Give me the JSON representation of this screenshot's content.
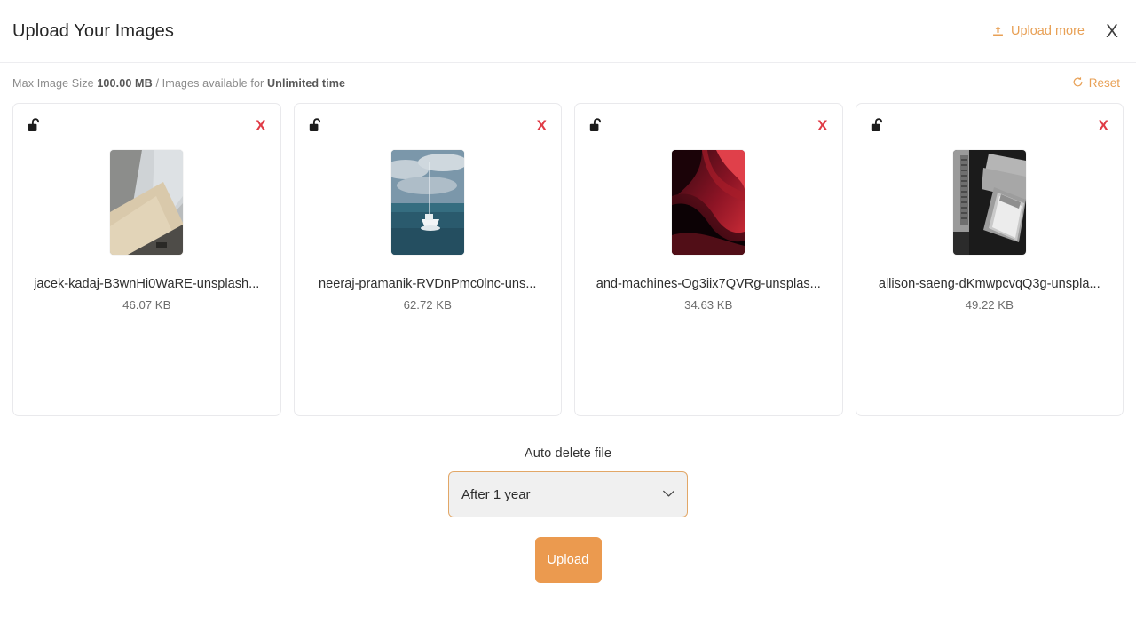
{
  "header": {
    "title": "Upload Your Images",
    "upload_more_label": "Upload more",
    "upload_more_icon": "upload-icon",
    "close_label": "X",
    "accent_color": "#e8a055"
  },
  "meta": {
    "prefix": "Max Image Size",
    "max_size": "100.00 MB",
    "middle": "/ Images available for",
    "availability": "Unlimited time",
    "reset_label": "Reset",
    "reset_icon": "refresh-icon"
  },
  "cards": [
    {
      "lock_icon": "unlock-icon",
      "remove_label": "X",
      "file_name": "jacek-kadaj-B3wnHi0WaRE-unsplash...",
      "file_size": "46.07 KB",
      "thumb_alt": "concrete-and-wood-surfaces-photo"
    },
    {
      "lock_icon": "unlock-icon",
      "remove_label": "X",
      "file_name": "neeraj-pramanik-RVDnPmc0lnc-uns...",
      "file_size": "62.72 KB",
      "thumb_alt": "sailboat-on-ocean-photo"
    },
    {
      "lock_icon": "unlock-icon",
      "remove_label": "X",
      "file_name": "and-machines-Og3iix7QVRg-unsplas...",
      "file_size": "34.63 KB",
      "thumb_alt": "abstract-red-black-waves-photo"
    },
    {
      "lock_icon": "unlock-icon",
      "remove_label": "X",
      "file_name": "allison-saeng-dKmwpcvqQ3g-unspla...",
      "file_size": "49.22 KB",
      "thumb_alt": "greyscale-phone-and-papers-photo"
    }
  ],
  "footer": {
    "select_label": "Auto delete file",
    "select_value": "After 1 year",
    "select_options": [
      "After 1 year"
    ],
    "upload_button_label": "Upload",
    "button_color": "#eb9a4f",
    "select_border_color": "#e2a767"
  }
}
